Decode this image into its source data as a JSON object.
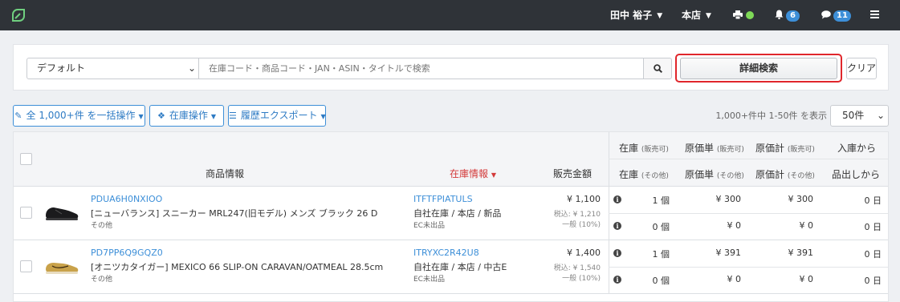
{
  "nav": {
    "user": "田中 裕子",
    "store": "本店",
    "notifications": "6",
    "messages": "11"
  },
  "search": {
    "preset": "デフォルト",
    "placeholder": "在庫コード・商品コード・JAN・ASIN・タイトルで検索",
    "detail_label": "詳細検索",
    "clear_label": "クリア"
  },
  "actions": {
    "bulk_label": "全 1,000+件 を一括操作",
    "stock_label": "在庫操作",
    "export_label": "履歴エクスポート",
    "count_text": "1,000+件中 1-50件 を表示",
    "per_page": "50件"
  },
  "table": {
    "headers": {
      "product": "商品情報",
      "stock_info": "在庫情報",
      "sale_price": "販売金額",
      "stock_sellable": "在庫",
      "stock_sellable_sub": "(販売可)",
      "stock_other": "在庫",
      "stock_other_sub": "(その他)",
      "unit_cost_sellable": "原価単",
      "unit_cost_sellable_sub": "(販売可)",
      "unit_cost_other": "原価単",
      "unit_cost_other_sub": "(その他)",
      "total_cost_sellable": "原価計",
      "total_cost_sellable_sub": "(販売可)",
      "total_cost_other": "原価計",
      "total_cost_other_sub": "(その他)",
      "since_in": "入庫から",
      "since_out": "品出しから"
    },
    "rows": [
      {
        "code": "PDUA6H0NXIOO",
        "name": "[ニューバランス] スニーカー MRL247(旧モデル) メンズ ブラック 26 D",
        "category": "その他",
        "stock_code": "ITFTFPIATULS",
        "stock_location": "自社在庫 / 本店 / 新品",
        "ec_status": "EC未出品",
        "price": "¥ 1,100",
        "tax_incl": "税込: ¥ 1,210",
        "tax_type": "一般 (10%)",
        "qty_sellable": "1 個",
        "qty_other": "0 個",
        "unit_sellable": "¥ 300",
        "unit_other": "¥ 0",
        "total_sellable": "¥ 300",
        "total_other": "¥ 0",
        "days_in": "0 日",
        "days_out": "0 日",
        "shoe_color": "#1b1b1d"
      },
      {
        "code": "PD7PP6Q9GQZ0",
        "name": "[オニツカタイガー] MEXICO 66 SLIP-ON CARAVAN/OATMEAL 28.5cm",
        "category": "その他",
        "stock_code": "ITRYXC2R42U8",
        "stock_location": "自社在庫 / 本店 / 中古E",
        "ec_status": "EC未出品",
        "price": "¥ 1,400",
        "tax_incl": "税込: ¥ 1,540",
        "tax_type": "一般 (10%)",
        "qty_sellable": "1 個",
        "qty_other": "0 個",
        "unit_sellable": "¥ 391",
        "unit_other": "¥ 0",
        "total_sellable": "¥ 391",
        "total_other": "¥ 0",
        "days_in": "0 日",
        "days_out": "0 日",
        "shoe_color": "#c9a24a"
      }
    ]
  },
  "colors": {
    "nav_bg": "#2f3338",
    "accent": "#3d8fd8",
    "highlight": "#e0262b",
    "status_green": "#7ed957"
  }
}
